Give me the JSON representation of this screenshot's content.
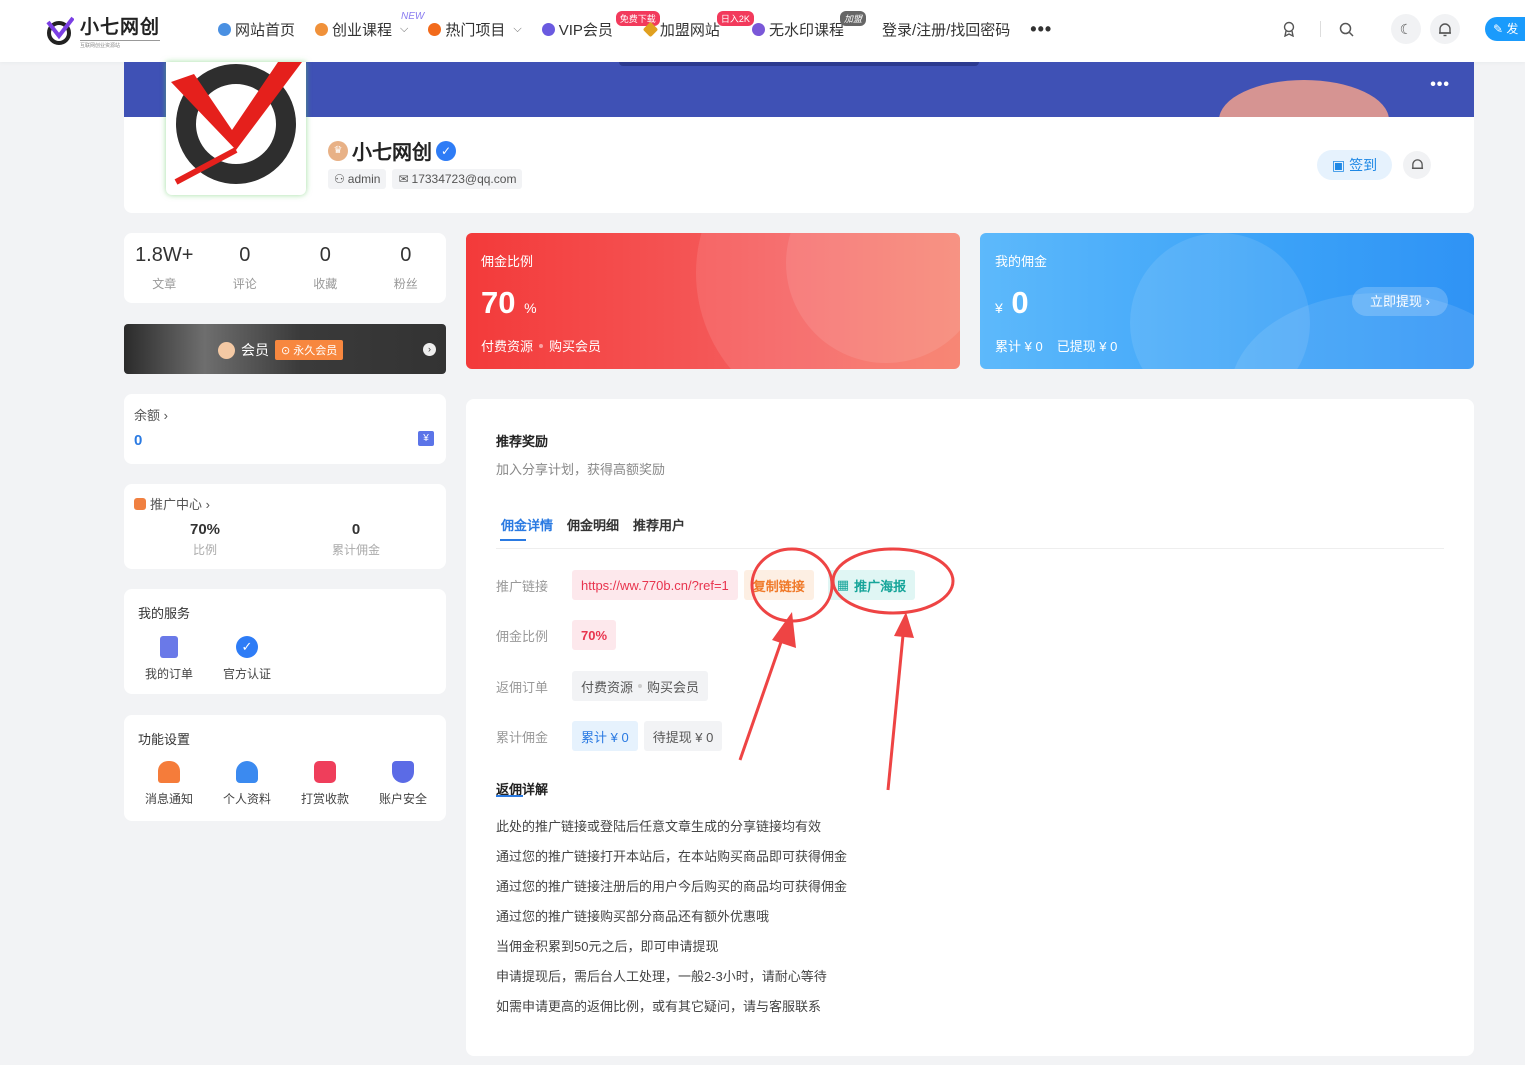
{
  "nav": {
    "logo_title": "小七网创",
    "logo_sub": "互联网创业资源站",
    "items": [
      {
        "label": "网站首页",
        "icon": "home-icon",
        "color": "#4a90e2",
        "caret": false,
        "badge": ""
      },
      {
        "label": "创业课程",
        "icon": "course-icon",
        "color": "#f0913a",
        "caret": true,
        "badge": "NEW"
      },
      {
        "label": "热门项目",
        "icon": "fire-icon",
        "color": "#f26a1b",
        "caret": true,
        "badge": ""
      },
      {
        "label": "VIP会员",
        "icon": "vip-icon",
        "color": "#6a5ae0",
        "caret": false,
        "badge": "免费下载"
      },
      {
        "label": "加盟网站",
        "icon": "diamond-icon",
        "color": "#e0a020",
        "caret": false,
        "badge": "日入2K"
      },
      {
        "label": "无水印课程",
        "icon": "globe-icon",
        "color": "#7a58d8",
        "caret": false,
        "badge": "加盟"
      },
      {
        "label": "登录/注册/找回密码",
        "icon": "",
        "color": "",
        "caret": false,
        "badge": ""
      }
    ],
    "more": "•••",
    "publish_label": "发"
  },
  "profile": {
    "name": "小七网创",
    "username": "admin",
    "email": "17334723@qq.com",
    "signin_label": "签到",
    "cover_more": "•••"
  },
  "stats": [
    {
      "value": "1.8W+",
      "label": "文章"
    },
    {
      "value": "0",
      "label": "评论"
    },
    {
      "value": "0",
      "label": "收藏"
    },
    {
      "value": "0",
      "label": "粉丝"
    }
  ],
  "vip": {
    "label": "会员",
    "badge": "永久会员"
  },
  "balance": {
    "title": "余额 ›",
    "value": "0",
    "icon": "¥"
  },
  "promo": {
    "title": "推广中心 ›",
    "ratio_value": "70%",
    "ratio_label": "比例",
    "total_value": "0",
    "total_label": "累计佣金"
  },
  "services": {
    "title": "我的服务",
    "items": [
      {
        "label": "我的订单",
        "icon": "order-icon",
        "color": "#6a79e8"
      },
      {
        "label": "官方认证",
        "icon": "verified-icon",
        "color": "#2e7cf6"
      }
    ]
  },
  "functions": {
    "title": "功能设置",
    "items": [
      {
        "label": "消息通知",
        "icon": "notification-icon",
        "color": "#f57c3a"
      },
      {
        "label": "个人资料",
        "icon": "profile-icon",
        "color": "#3b8af0"
      },
      {
        "label": "打赏收款",
        "icon": "gift-icon",
        "color": "#ef3e5b"
      },
      {
        "label": "账户安全",
        "icon": "shield-icon",
        "color": "#5b6be6"
      }
    ]
  },
  "commission_rate_card": {
    "title": "佣金比例",
    "value": "70",
    "unit": "%",
    "tags": [
      "付费资源",
      "购买会员"
    ]
  },
  "my_commission_card": {
    "title": "我的佣金",
    "currency": "¥",
    "value": "0",
    "total": "累计 ¥ 0",
    "withdrawn": "已提现 ¥ 0",
    "withdraw_label": "立即提现 ›"
  },
  "main": {
    "title": "推荐奖励",
    "subtitle": "加入分享计划，获得高额奖励",
    "tabs": [
      "佣金详情",
      "佣金明细",
      "推荐用户"
    ],
    "rows": {
      "link_label": "推广链接",
      "link_value": "https://ww.770b.cn/?ref=1",
      "copy_label": "复制链接",
      "poster_label": "推广海报",
      "ratio_label": "佣金比例",
      "ratio_value": "70%",
      "order_label": "返佣订单",
      "order_tags": [
        "付费资源",
        "购买会员"
      ],
      "total_label": "累计佣金",
      "total_value": "累计 ¥ 0",
      "pending_value": "待提现 ¥ 0"
    },
    "rules_title": "返佣详解",
    "rules": [
      "此处的推广链接或登陆后任意文章生成的分享链接均有效",
      "通过您的推广链接打开本站后，在本站购买商品即可获得佣金",
      "通过您的推广链接注册后的用户今后购买的商品均可获得佣金",
      "通过您的推广链接购买部分商品还有额外优惠哦",
      "当佣金积累到50元之后，即可申请提现",
      "申请提现后，需后台人工处理，一般2-3小时，请耐心等待",
      "如需申请更高的返佣比例，或有其它疑问，请与客服联系"
    ]
  },
  "colors": {
    "accent": "#2a7ae2",
    "red": "#f33a3a",
    "blue": "#3ba2f8",
    "annotation": "#ee4444"
  }
}
